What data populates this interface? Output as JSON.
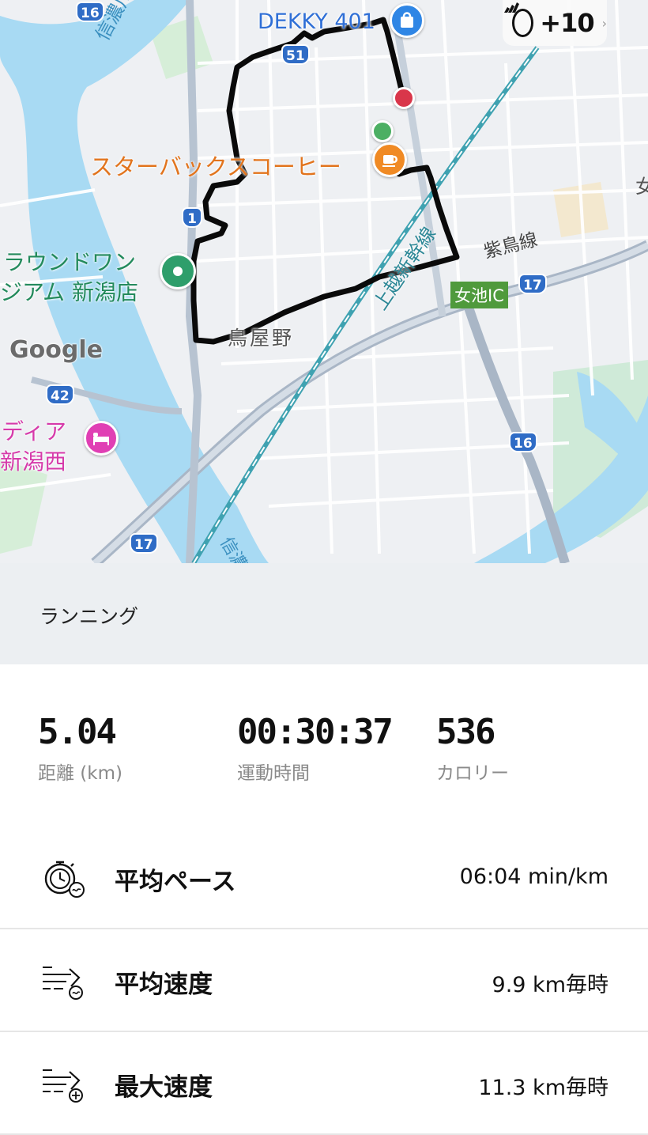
{
  "map": {
    "labels": {
      "poi_dekky": "DEKKY 401",
      "poi_starbucks": "スターバックスコーヒー",
      "poi_round1_line1": "ラウンドワン",
      "poi_round1_line2": "ジアム 新潟店",
      "poi_hotel_line1": "ディア",
      "poi_hotel_line2": "新潟西",
      "river_top": "信濃川",
      "river_bottom": "信濃",
      "rail_line": "上越新幹線",
      "road_shichiku": "紫鳥線",
      "place_toriyano": "鳥屋野",
      "interchange": "女池IC",
      "edge_label": "女",
      "google": "Google"
    },
    "route_shields": {
      "r16_top": "16",
      "r51": "51",
      "r1": "1",
      "r42": "42",
      "r17_right": "17",
      "r16_bottom": "16",
      "r17_bottom": "17"
    },
    "icons": {
      "dekky": "shopping-bag-icon",
      "starbucks": "coffee-cup-icon",
      "round1": "location-pin-icon",
      "hotel": "hotel-bed-icon",
      "start_marker": "start-point-icon",
      "end_marker": "end-point-icon"
    }
  },
  "points_badge": {
    "value": "+10",
    "icon": "brand-logo-icon"
  },
  "activity": {
    "type_label": "ランニング"
  },
  "stats": [
    {
      "value": "5.04",
      "label": "距離 (km)"
    },
    {
      "value": "00:30:37",
      "label": "運動時間"
    },
    {
      "value": "536",
      "label": "カロリー"
    }
  ],
  "metrics": [
    {
      "name": "平均ペース",
      "value": "06:04 min/km",
      "icon": "stopwatch-icon"
    },
    {
      "name": "平均速度",
      "value": "9.9 km毎時",
      "icon": "speed-average-icon"
    },
    {
      "name": "最大速度",
      "value": "11.3 km毎時",
      "icon": "speed-max-icon"
    }
  ],
  "colors": {
    "river": "#a8daf3",
    "route": "#0a0a0a",
    "highway": "#a9b6c6",
    "rail": "#3fa2b1",
    "poi_green": "#2e9e6b",
    "poi_orange": "#f08a24",
    "poi_blue": "#2f86e5",
    "poi_pink": "#e03fb4",
    "end_red": "#d9364a",
    "start_green": "#4caf63"
  }
}
